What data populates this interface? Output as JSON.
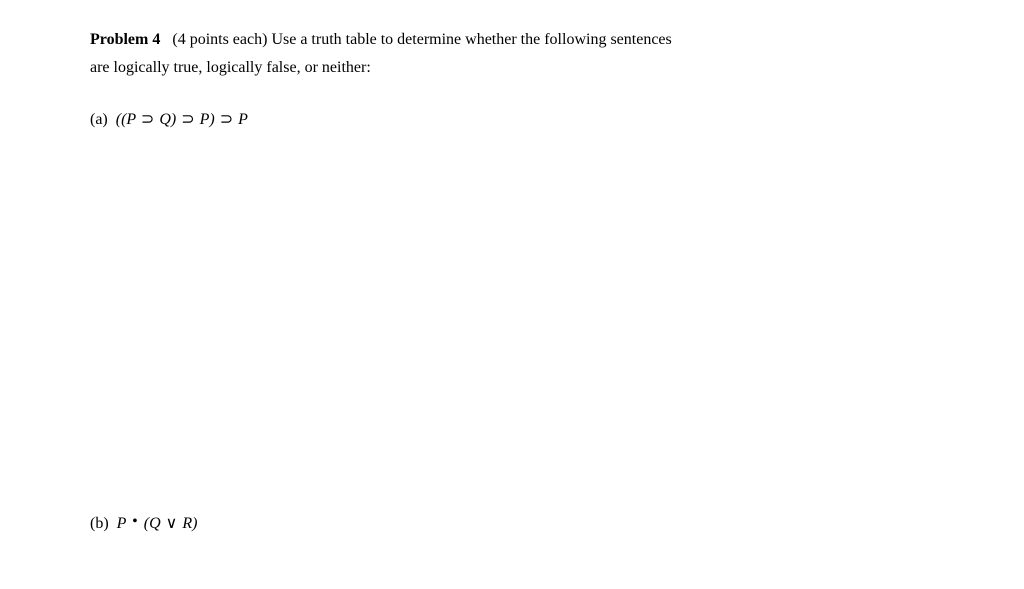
{
  "header": {
    "problem_label": "Problem 4",
    "points": "(4 points each)",
    "instruction_line1": "Use a truth table to determine whether the following sentences",
    "instruction_line2": "are logically true, logically false, or neither:"
  },
  "parts": {
    "a": {
      "label": "(a)",
      "formula_prefix": "((",
      "P1": "P",
      "sup1": "⊃",
      "Q1": "Q",
      "mid1": ")",
      "sup2": "⊃",
      "P2": "P",
      "mid2": ")",
      "sup3": "⊃",
      "P3": "P"
    },
    "b": {
      "label": "(b)",
      "P": "P",
      "dot": "•",
      "open": "(",
      "Q": "Q",
      "vee": "∨",
      "R": "R",
      "close": ")"
    }
  }
}
